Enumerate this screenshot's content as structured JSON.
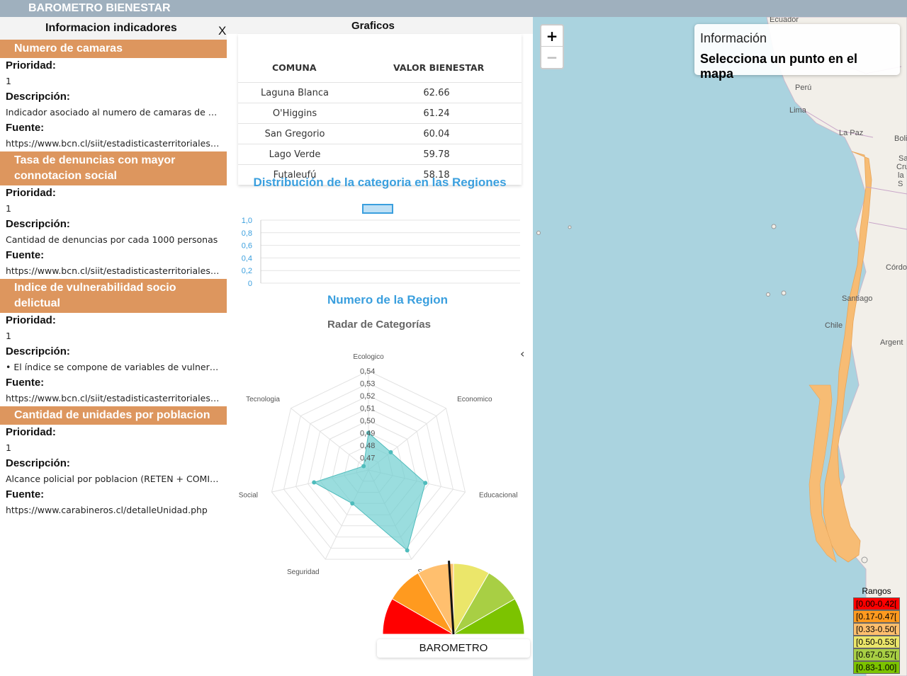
{
  "app": {
    "title": "BAROMETRO BIENESTAR"
  },
  "left_panel": {
    "title": "Informacion indicadores",
    "close": "X",
    "labels": {
      "priority": "Prioridad:",
      "description": "Descripción:",
      "source": "Fuente:"
    },
    "indicators": [
      {
        "name": "Numero de camaras",
        "priority": "1",
        "description": "Indicador asociado al numero de camaras de vi...",
        "source": "https://www.bcn.cl/siit/estadisticasterritoriales//..."
      },
      {
        "name": "Tasa de denuncias con mayor connotacion social",
        "priority": "1",
        "description": "Cantidad de denuncias por cada 1000 personas",
        "source": "https://www.bcn.cl/siit/estadisticasterritoriales/t..."
      },
      {
        "name": "Indice de vulnerabilidad socio delictual",
        "priority": "1",
        "description": "• El índice se compone de variables de vulnerab...",
        "source": "https://www.bcn.cl/siit/estadisticasterritoriales//..."
      },
      {
        "name": "Cantidad de unidades por poblacion",
        "priority": "1",
        "description": "Alcance policial por poblacion (RETEN + COMIS...",
        "source": "https://www.carabineros.cl/detalleUnidad.php"
      }
    ]
  },
  "graficos": {
    "title": "Graficos",
    "table": {
      "headers": [
        "COMUNA",
        "VALOR BIENESTAR"
      ],
      "rows": [
        [
          "Laguna Blanca",
          "62.66"
        ],
        [
          "O'Higgins",
          "61.24"
        ],
        [
          "San Gregorio",
          "60.04"
        ],
        [
          "Lago Verde",
          "59.78"
        ],
        [
          "Futaleufú",
          "58.18"
        ]
      ]
    },
    "collapse_icon": "chevron-left-icon",
    "barometer_label": "BAROMETRO"
  },
  "chart_data": [
    {
      "type": "bar",
      "title": "Distribución de la categoria en las Regiones",
      "xlabel": "Numero de la Region",
      "ylabel": "",
      "ylim": [
        0,
        1
      ],
      "yticks": [
        "1,0",
        "0,8",
        "0,6",
        "0,4",
        "0,2",
        "0"
      ],
      "categories": [],
      "values": [],
      "legend_position": "top",
      "color": "#3a9fde"
    },
    {
      "type": "radar",
      "title": "Radar de Categorías",
      "categories": [
        "Ecologico",
        "Economico",
        "Educacional",
        "Salud",
        "Seguridad",
        "Social",
        "Tecnologia"
      ],
      "values": [
        0.495,
        0.488,
        0.512,
        0.537,
        0.495,
        0.51,
        0.47
      ],
      "rlim": [
        0.465,
        0.545
      ],
      "rticks": [
        "0,47",
        "0,48",
        "0,49",
        "0,50",
        "0,51",
        "0,52",
        "0,53",
        "0,54"
      ],
      "color": "#6fcfd0"
    },
    {
      "type": "gauge",
      "title": "",
      "label": "BAROMETRO",
      "value": 0.48,
      "range": [
        0,
        1
      ]
    }
  ],
  "map": {
    "zoom_in": "+",
    "zoom_out": "−",
    "info_title": "Información",
    "info_message": "Selecciona un punto en el mapa",
    "place_labels": [
      "Ecuador",
      "Perú",
      "Lima",
      "La Paz",
      "Boliv",
      "Sa",
      "Cru",
      "la S",
      "Córdo",
      "Santiago",
      "Chile",
      "Argent"
    ],
    "legend": {
      "title": "Rangos",
      "items": [
        {
          "label": "[0.00-0.42[",
          "color": "#ff0000"
        },
        {
          "label": "[0.17-0.47[",
          "color": "#ff9a1f"
        },
        {
          "label": "[0.33-0.50[",
          "color": "#ffbf6e"
        },
        {
          "label": "[0.50-0.53[",
          "color": "#ebe66a"
        },
        {
          "label": "[0.67-0.57[",
          "color": "#a8cf44"
        },
        {
          "label": "[0.83-1.00]",
          "color": "#7cc300"
        }
      ]
    },
    "region_color": "#f7bc74"
  }
}
